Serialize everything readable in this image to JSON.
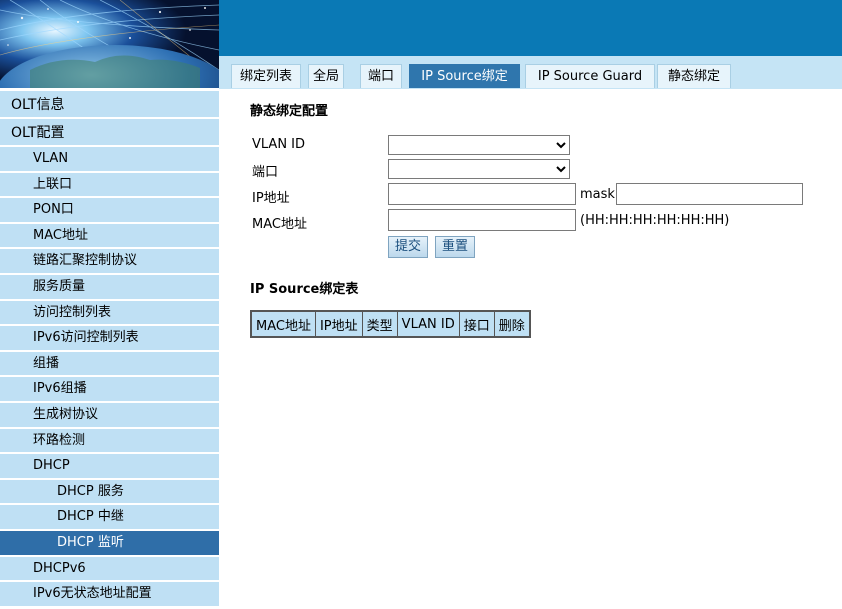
{
  "header": {
    "banner": "globe-network-banner"
  },
  "tabs": [
    {
      "label": "绑定列表",
      "active": false
    },
    {
      "label": "全局",
      "active": false
    },
    {
      "label": "端口",
      "active": false
    },
    {
      "label": "IP Source绑定",
      "active": true
    },
    {
      "label": "IP Source Guard",
      "active": false
    },
    {
      "label": "静态绑定",
      "active": false
    }
  ],
  "sidebar": {
    "items": [
      {
        "label": "OLT信息",
        "level": 0
      },
      {
        "label": "OLT配置",
        "level": 0
      },
      {
        "label": "VLAN",
        "level": 1
      },
      {
        "label": "上联口",
        "level": 1
      },
      {
        "label": "PON口",
        "level": 1
      },
      {
        "label": "MAC地址",
        "level": 1
      },
      {
        "label": "链路汇聚控制协议",
        "level": 1
      },
      {
        "label": "服务质量",
        "level": 1
      },
      {
        "label": "访问控制列表",
        "level": 1
      },
      {
        "label": "IPv6访问控制列表",
        "level": 1
      },
      {
        "label": "组播",
        "level": 1
      },
      {
        "label": "IPv6组播",
        "level": 1
      },
      {
        "label": "生成树协议",
        "level": 1
      },
      {
        "label": "环路检测",
        "level": 1
      },
      {
        "label": "DHCP",
        "level": 1
      },
      {
        "label": "DHCP 服务",
        "level": 2
      },
      {
        "label": "DHCP 中继",
        "level": 2
      },
      {
        "label": "DHCP 监听",
        "level": 2,
        "active": true
      },
      {
        "label": "DHCPv6",
        "level": 1
      },
      {
        "label": "IPv6无状态地址配置",
        "level": 1
      }
    ]
  },
  "form": {
    "title": "静态绑定配置",
    "vlan_label": "VLAN ID",
    "vlan_value": "",
    "port_label": "端口",
    "port_value": "",
    "ip_label": "IP地址",
    "ip_value": "",
    "mask_label": "mask",
    "mask_value": "",
    "mac_label": "MAC地址",
    "mac_value": "",
    "mac_hint": "(HH:HH:HH:HH:HH:HH)",
    "submit_label": "提交",
    "reset_label": "重置"
  },
  "table": {
    "title": "IP Source绑定表",
    "headers": [
      "MAC地址",
      "IP地址",
      "类型",
      "VLAN ID",
      "接口",
      "删除"
    ],
    "rows": []
  },
  "colors": {
    "topbar": "#0a79b5",
    "tab_active": "#2f76ad",
    "sidebar_item": "#bfe0f4",
    "sidebar_active": "#2f6ea8"
  }
}
